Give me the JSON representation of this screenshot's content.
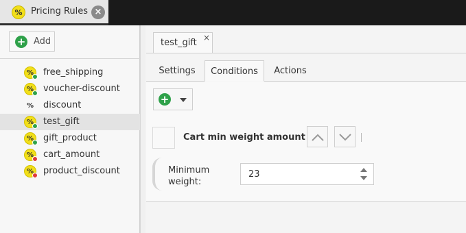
{
  "window_tab": {
    "title": "Pricing Rules",
    "icon": "percent-icon",
    "close_glyph": "×"
  },
  "sidebar": {
    "add_label": "Add",
    "items": [
      {
        "label": "free_shipping",
        "badge": "green"
      },
      {
        "label": "voucher-discount",
        "badge": "green"
      },
      {
        "label": "discount",
        "badge": "none"
      },
      {
        "label": "test_gift",
        "badge": "green",
        "selected": true
      },
      {
        "label": "gift_product",
        "badge": "green"
      },
      {
        "label": "cart_amount",
        "badge": "red"
      },
      {
        "label": "product_discount",
        "badge": "red"
      }
    ]
  },
  "editor": {
    "doc_tab": "test_gift",
    "doc_tab_close": "×",
    "tabs": [
      {
        "label": "Settings"
      },
      {
        "label": "Conditions",
        "active": true
      },
      {
        "label": "Actions"
      }
    ],
    "condition": {
      "title": "Cart min weight amount",
      "field_label": "Minimum weight:",
      "field_value": "23"
    }
  },
  "colors": {
    "accent_green": "#2fa14a",
    "icon_yellow": "#f2df19",
    "alert_red": "#e03a3a",
    "topbar": "#1a1a1a"
  }
}
